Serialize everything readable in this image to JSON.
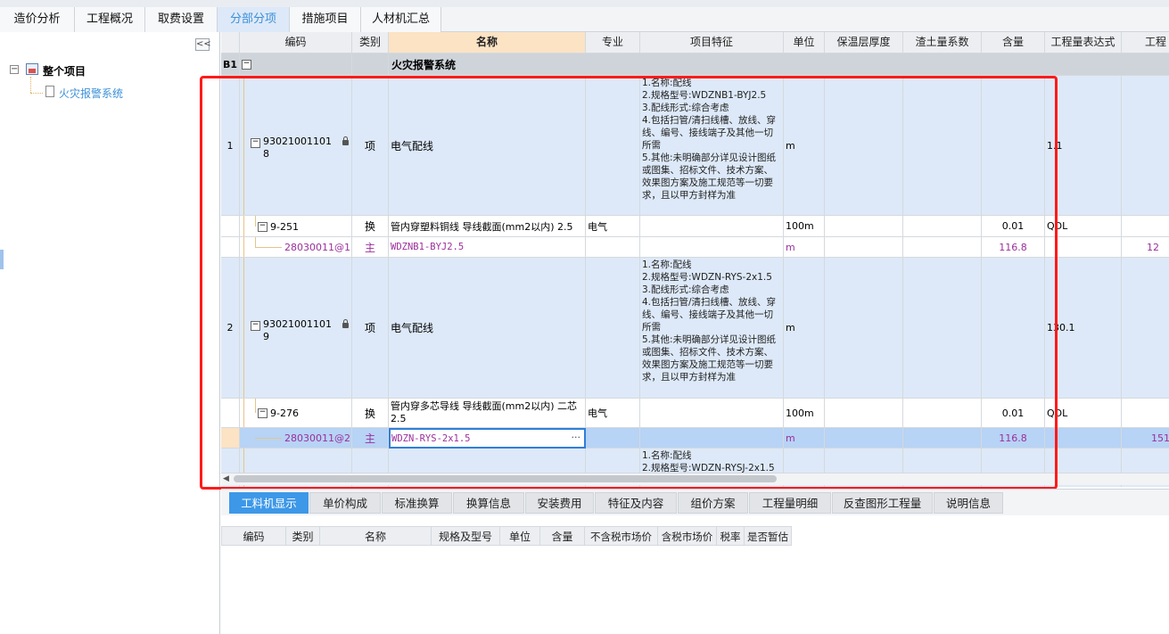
{
  "tabs": [
    "造价分析",
    "工程概况",
    "取费设置",
    "分部分项",
    "措施项目",
    "人材机汇总"
  ],
  "active_tab": "分部分项",
  "tree": {
    "collapse_symbol": "<<",
    "root": "整个项目",
    "child": "火灾报警系统"
  },
  "grid": {
    "headers": [
      "编码",
      "类别",
      "名称",
      "专业",
      "项目特征",
      "单位",
      "保温层厚度",
      "渣土量系数",
      "含量",
      "工程量表达式",
      "工程量"
    ],
    "section": {
      "id": "B1",
      "name": "火灾报警系统"
    },
    "rows": [
      {
        "no": "1",
        "code": "930210011018",
        "code_lines": [
          "93021001101",
          "8"
        ],
        "type": "项",
        "name": "电气配线",
        "profession": "",
        "feature": "1.名称:配线\n2.规格型号:WDZNB1-BYJ2.5\n3.配线形式:综合考虑\n4.包括扫管/清扫线槽、放线、穿线、编号、接线端子及其他一切所需\n5.其他:未明确部分详见设计图纸或图集、招标文件、技术方案、效果图方案及施工规范等一切要求，且以甲方封样为准",
        "unit": "m",
        "content": "",
        "expr": "1.1",
        "qty": ""
      },
      {
        "no": "",
        "code": "9-251",
        "type": "换",
        "name": "管内穿塑料铜线 导线截面(mm2以内) 2.5",
        "profession": "电气",
        "feature": "",
        "unit": "100m",
        "content": "0.01",
        "expr": "QDL",
        "qty": ""
      },
      {
        "no": "",
        "code": "28030011@1",
        "type": "主",
        "name": "WDZNB1-BYJ2.5",
        "profession": "",
        "feature": "",
        "unit": "m",
        "content": "116.8",
        "expr": "",
        "qty": "12"
      },
      {
        "no": "2",
        "code": "930210011019",
        "code_lines": [
          "93021001101",
          "9"
        ],
        "type": "项",
        "name": "电气配线",
        "profession": "",
        "feature": "1.名称:配线\n2.规格型号:WDZN-RYS-2x1.5\n3.配线形式:综合考虑\n4.包括扫管/清扫线槽、放线、穿线、编号、接线端子及其他一切所需\n5.其他:未明确部分详见设计图纸或图集、招标文件、技术方案、效果图方案及施工规范等一切要求，且以甲方封样为准",
        "unit": "m",
        "content": "",
        "expr": "130.1",
        "qty": ""
      },
      {
        "no": "",
        "code": "9-276",
        "type": "换",
        "name": "管内穿多芯导线 导线截面(mm2以内) 二芯 2.5",
        "profession": "电气",
        "feature": "",
        "unit": "100m",
        "content": "0.01",
        "expr": "QDL",
        "qty": ""
      },
      {
        "no": "",
        "code": "28030011@2",
        "type": "主",
        "name": "WDZN-RYS-2x1.5",
        "profession": "",
        "feature": "",
        "unit": "m",
        "content": "116.8",
        "expr": "",
        "qty": "151"
      },
      {
        "no": "",
        "code": "",
        "type": "",
        "name": "",
        "profession": "",
        "feature": "1.名称:配线\n2.规格型号:WDZN-RYSJ-2x1.5",
        "unit": "",
        "content": "",
        "expr": "",
        "qty": ""
      }
    ],
    "ellipsis": "···",
    "expand_symbol": "−"
  },
  "bottom_tabs": [
    "工料机显示",
    "单价构成",
    "标准换算",
    "换算信息",
    "安装费用",
    "特征及内容",
    "组价方案",
    "工程量明细",
    "反查图形工程量",
    "说明信息"
  ],
  "active_bottom_tab": "工料机显示",
  "bottom_headers": [
    "编码",
    "类别",
    "名称",
    "规格及型号",
    "单位",
    "含量",
    "不含税市场价",
    "含税市场价",
    "税率",
    "是否暂估"
  ],
  "colors": {
    "annotation": "#ff1a1a",
    "row_fill": "#dde9f8",
    "selected": "#b7d3f5",
    "accent": "#3d98e8",
    "purple_text": "#9b2f9b"
  }
}
